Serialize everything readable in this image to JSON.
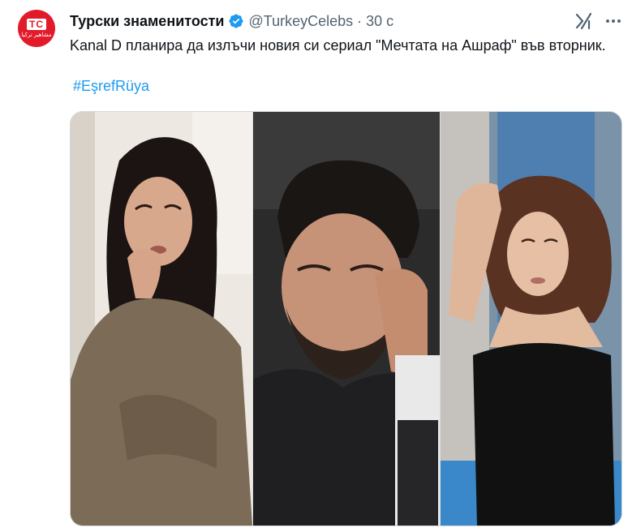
{
  "tweet": {
    "author_name": "Турски знаменитости",
    "handle": "@TurkeyCelebs",
    "separator": "·",
    "time": "30 с",
    "text": "Kanal D планира да излъчи новия си сериал \"Мечтата на Ашраф\" във вторник.",
    "hashtag": "#EşrefRüya",
    "avatar": {
      "mark": "TC",
      "subtitle": "مشاهير تركيا",
      "color": "#e21b2b"
    },
    "verified_color": "#1d9bf0",
    "link_color": "#1d9bf0"
  },
  "icons": [
    "verified-badge-icon",
    "grok-icon",
    "more-options-icon"
  ],
  "media": {
    "images": [
      {
        "name": "photo-woman-dark-hair"
      },
      {
        "name": "photo-man-beard"
      },
      {
        "name": "photo-woman-wavy-hair"
      }
    ]
  }
}
